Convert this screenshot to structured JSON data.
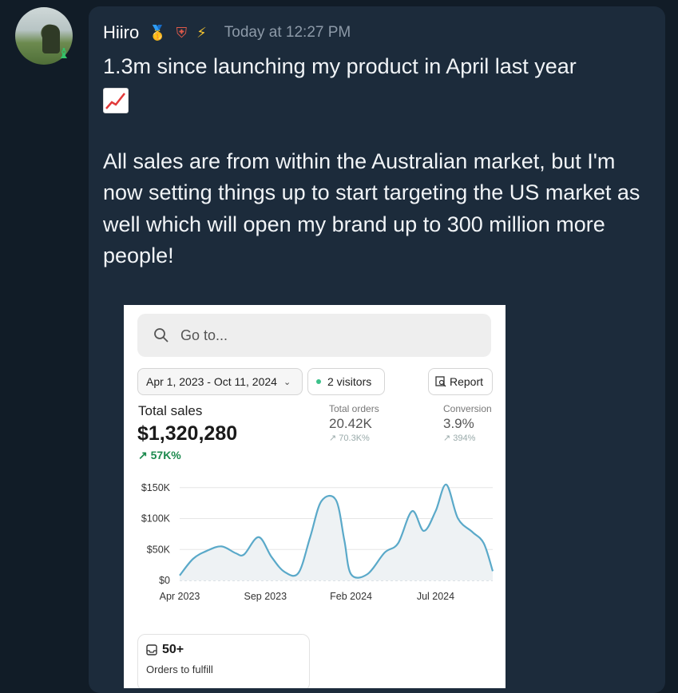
{
  "user": {
    "name": "Hiiro",
    "badges": [
      "medal-icon",
      "shield-icon",
      "lightning-icon"
    ],
    "timestamp": "Today at 12:27 PM"
  },
  "message": {
    "line1": "1.3m since launching my product in April last year",
    "emoji": "chart-increasing-icon",
    "paragraph2": "All sales are from within the Australian market, but I'm now setting things up to start targeting the US market as well which will open my brand up to 300 million more people!"
  },
  "screenshot": {
    "search_placeholder": "Go to...",
    "date_range": "Apr 1, 2023 - Oct 11, 2024",
    "visitors": "2 visitors",
    "report_label": "Report",
    "total_sales_label": "Total sales",
    "total_sales_value": "$1,320,280",
    "total_sales_change": "57K%",
    "total_orders_label": "Total orders",
    "total_orders_value": "20.42K",
    "total_orders_change": "70.3K%",
    "conversion_label": "Conversion",
    "conversion_value": "3.9%",
    "conversion_change": "394%",
    "fulfill_count": "50+",
    "fulfill_label": "Orders to fulfill",
    "accent_color": "#5aa9c9",
    "positive_color": "#1c8a4e"
  },
  "chart_data": {
    "type": "area",
    "ytick_labels": [
      "$0",
      "$50K",
      "$100K",
      "$150K"
    ],
    "xtick_labels": [
      "Apr 2023",
      "Sep 2023",
      "Feb 2024",
      "Jul 2024"
    ],
    "ylim": [
      0,
      160000
    ],
    "series": [
      {
        "values": [
          {
            "x": "2023-04-01",
            "y": 8000
          },
          {
            "x": "2023-04-25",
            "y": 35000
          },
          {
            "x": "2023-05-20",
            "y": 48000
          },
          {
            "x": "2023-06-15",
            "y": 55000
          },
          {
            "x": "2023-07-10",
            "y": 44000
          },
          {
            "x": "2023-07-25",
            "y": 42000
          },
          {
            "x": "2023-08-20",
            "y": 70000
          },
          {
            "x": "2023-09-12",
            "y": 38000
          },
          {
            "x": "2023-10-05",
            "y": 14000
          },
          {
            "x": "2023-10-30",
            "y": 12000
          },
          {
            "x": "2023-11-20",
            "y": 70000
          },
          {
            "x": "2023-12-10",
            "y": 128000
          },
          {
            "x": "2024-01-05",
            "y": 130000
          },
          {
            "x": "2024-01-20",
            "y": 65000
          },
          {
            "x": "2024-02-01",
            "y": 10000
          },
          {
            "x": "2024-03-01",
            "y": 10000
          },
          {
            "x": "2024-04-01",
            "y": 45000
          },
          {
            "x": "2024-04-25",
            "y": 60000
          },
          {
            "x": "2024-05-20",
            "y": 112000
          },
          {
            "x": "2024-06-10",
            "y": 80000
          },
          {
            "x": "2024-07-01",
            "y": 112000
          },
          {
            "x": "2024-07-20",
            "y": 155000
          },
          {
            "x": "2024-08-10",
            "y": 100000
          },
          {
            "x": "2024-09-05",
            "y": 78000
          },
          {
            "x": "2024-09-25",
            "y": 60000
          },
          {
            "x": "2024-10-11",
            "y": 15000
          }
        ]
      }
    ]
  }
}
